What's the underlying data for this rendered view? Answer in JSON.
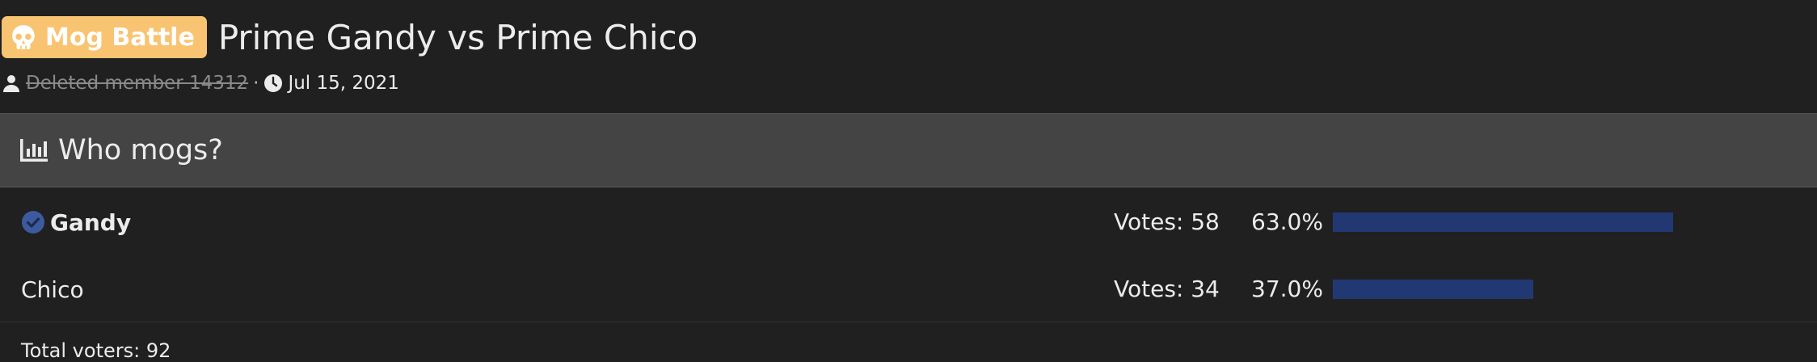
{
  "thread": {
    "badge": "Mog Battle",
    "title": "Prime Gandy vs Prime Chico",
    "author": "Deleted member 14312",
    "separator": "·",
    "date": "Jul 15, 2021"
  },
  "poll": {
    "question": "Who mogs?",
    "options": [
      {
        "label": "Gandy",
        "votes_text": "Votes: 58",
        "percent_text": "63.0%",
        "percent": 63.0,
        "voted": true
      },
      {
        "label": "Chico",
        "votes_text": "Votes: 34",
        "percent_text": "37.0%",
        "percent": 37.0,
        "voted": false
      }
    ],
    "total_text": "Total voters: 92"
  },
  "colors": {
    "badge": "#f8c471",
    "bar": "#223872",
    "check": "#3e5a9e"
  }
}
